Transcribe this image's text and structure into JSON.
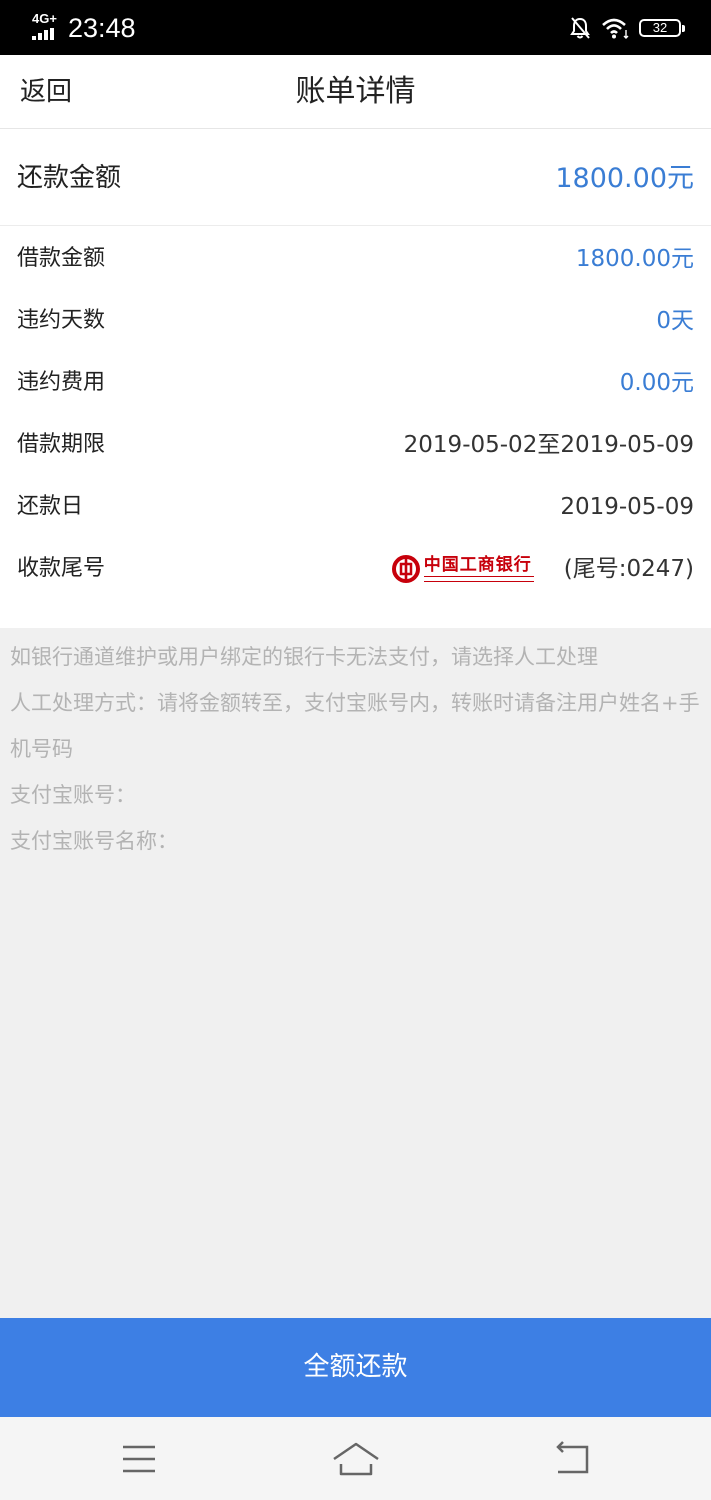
{
  "status_bar": {
    "network": "4G+",
    "time": "23:48",
    "battery": "32",
    "icons": [
      "signal-icon",
      "mute-icon",
      "wifi-icon",
      "battery-icon"
    ]
  },
  "header": {
    "back_label": "返回",
    "title": "账单详情"
  },
  "summary": {
    "label": "还款金额",
    "value": "1800.00元"
  },
  "details": [
    {
      "label": "借款金额",
      "value": "1800.00元"
    },
    {
      "label": "违约天数",
      "value": "0天"
    },
    {
      "label": "违约费用",
      "value": "0.00元"
    },
    {
      "label": "借款期限",
      "value": "2019-05-02至2019-05-09"
    },
    {
      "label": "还款日",
      "value": "2019-05-09"
    },
    {
      "label": "收款尾号",
      "bank_name": "中国工商银行",
      "tail": "(尾号:0247)"
    }
  ],
  "notice": {
    "lines": [
      "如银行通道维护或用户绑定的银行卡无法支付，请选择人工处理",
      "人工处理方式：请将金额转至，支付宝账号内，转账时请备注用户姓名+手机号码",
      "支付宝账号：",
      "支付宝账号名称："
    ]
  },
  "actions": {
    "repay_label": "全额还款"
  },
  "colors": {
    "accent": "#3a7dd4",
    "button": "#3d7fe4",
    "notice_bg": "#f0f0f0",
    "notice_text": "#b3b3b3",
    "bank_red": "#c7000b"
  },
  "system_nav": {
    "icons": [
      "menu-icon",
      "home-icon",
      "back-icon"
    ]
  }
}
